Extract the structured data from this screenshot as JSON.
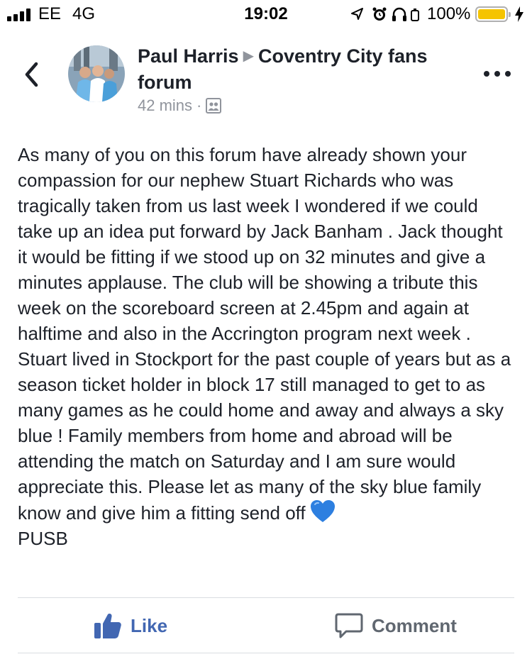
{
  "status_bar": {
    "carrier": "EE",
    "network": "4G",
    "time": "19:02",
    "battery_percent": "100%",
    "battery_level": 1.0,
    "icons": [
      "signal-icon",
      "location-icon",
      "alarm-icon",
      "headphones-icon",
      "battery-icon",
      "charging-icon"
    ]
  },
  "post": {
    "author": "Paul Harris",
    "group": "Coventry City fans forum",
    "time_ago": "42 mins",
    "dot": "·",
    "audience_icon": "group-audience-icon",
    "text": "As many of you on this forum have already shown your compassion for our nephew Stuart Richards who was tragically taken from us last week I wondered if we could take up an idea put forward by Jack Banham . Jack thought it would be fitting if we stood up on 32 minutes and give a minutes applause. The club will be showing a tribute this week on the scoreboard screen at 2.45pm and again at halftime and also in the Accrington program next week . Stuart lived in Stockport for the past couple of years but as a season ticket holder in block 17 still managed to get to as many games as he could home and away and always a sky blue ! Family members from home and abroad will be attending the match on Saturday and I am sure would appreciate this. Please let as many of the sky blue family know and give him a fitting send off",
    "emoji": "blue-heart-icon",
    "signoff": "PUSB"
  },
  "actions": {
    "like_label": "Like",
    "comment_label": "Comment"
  },
  "colors": {
    "like_blue": "#4267b2",
    "meta_gray": "#90949c",
    "battery_yellow": "#f5c400",
    "heart_blue": "#2d7fe0"
  }
}
